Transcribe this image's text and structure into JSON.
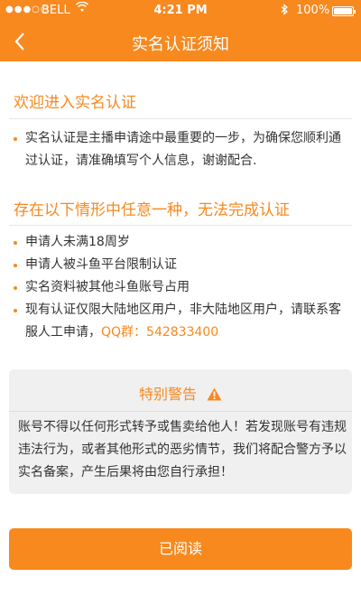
{
  "status_bar": {
    "signal": "●●●○○",
    "carrier": "BELL",
    "time": "4:21 PM",
    "battery": "100%"
  },
  "nav": {
    "back_icon": "chevron-left-icon",
    "title": "实名认证须知"
  },
  "welcome": {
    "heading": "欢迎进入实名认证",
    "items": [
      "实名认证是主播申请途中最重要的一步，为确保您顺利通过认证，请准确填写个人信息，谢谢配合."
    ]
  },
  "conditions": {
    "heading": "存在以下情形中任意一种，无法完成认证",
    "items": [
      "申请人未满18周岁",
      "申请人被斗鱼平台限制认证",
      "实名资料被其他斗鱼账号占用"
    ],
    "last_item": {
      "text": "现有认证仅限大陆地区用户，非大陆地区用户，请联系客服人工申请，",
      "qq": "QQ群：542833400"
    }
  },
  "warning": {
    "heading": "特别警告",
    "icon": "warning-triangle-icon",
    "body": "账号不得以任何形式转予或售卖给他人！若发现账号有违规违法行为，或者其他形式的恶劣情节，我们将配合警方予以实名备案，产生后果将由您自行承担！"
  },
  "footer": {
    "read_button": "已阅读"
  },
  "colors": {
    "accent": "#f7891e",
    "warning_bg": "#f0f0f0"
  }
}
